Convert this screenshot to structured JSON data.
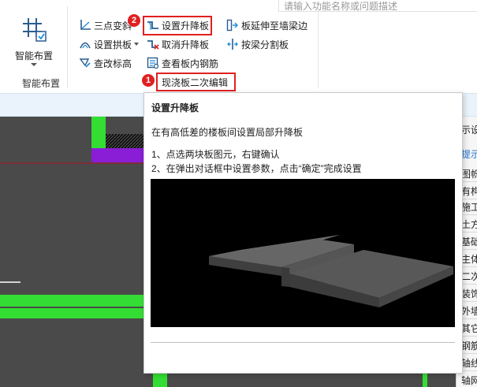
{
  "search": {
    "placeholder": "请输入功能名称或问题描述"
  },
  "ribbon": {
    "big_button": {
      "label": "智能布置",
      "icon": "grid-layout-icon"
    },
    "group_label": "智能布置",
    "col1": [
      {
        "label": "三点变斜",
        "icon": "three-point-slope-icon"
      },
      {
        "label": "设置拱板",
        "icon": "arch-slab-icon"
      },
      {
        "label": "查改标高",
        "icon": "elevation-edit-icon"
      }
    ],
    "col2": [
      {
        "label": "设置升降板",
        "icon": "raise-slab-icon"
      },
      {
        "label": "取消升降板",
        "icon": "cancel-raise-slab-icon"
      },
      {
        "label": "查看板内钢筋",
        "icon": "view-rebar-icon"
      },
      {
        "label": "现浇板二次编辑"
      }
    ],
    "col3": [
      {
        "label": "板延伸至墙梁边",
        "icon": "slab-extend-icon"
      },
      {
        "label": "按梁分割板",
        "icon": "split-slab-icon"
      }
    ]
  },
  "badges": {
    "step1": "1",
    "step2": "2"
  },
  "tooltip": {
    "title": "设置升降板",
    "description": "在有高低差的楼板间设置局部升降板",
    "step1": "1、点选两块板图元，右键确认",
    "step2": "2、在弹出对话框中设置参数，点击“确定”完成设置"
  },
  "right_panel": {
    "header_partial": "示设",
    "link_partial": "提示",
    "items": [
      "图帜",
      "有构",
      "施工段",
      "土方",
      "基础",
      "主体",
      "二次",
      "装饰",
      "外墙",
      "其它",
      "钢筋",
      "轴线",
      "轴网"
    ]
  },
  "colors": {
    "highlight": "#e02020",
    "canvas": "#4a4a4a",
    "green": "#33dd33",
    "purple": "#8a1ed6"
  }
}
